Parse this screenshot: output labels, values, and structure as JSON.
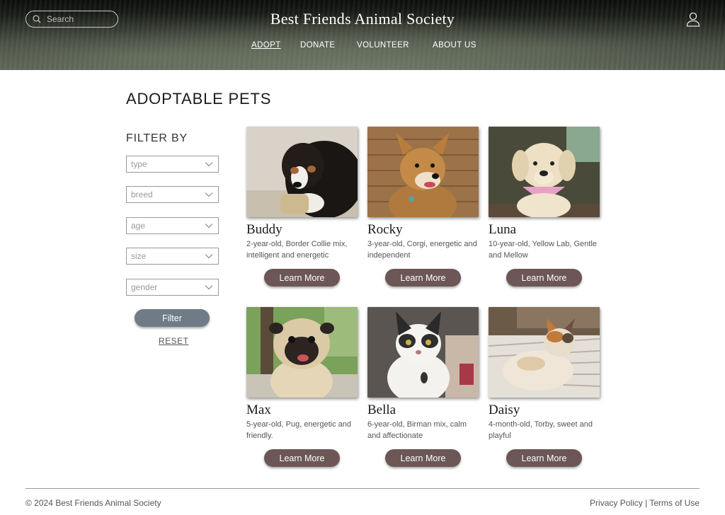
{
  "header": {
    "site_title": "Best Friends Animal Society",
    "search_placeholder": "Search",
    "nav": [
      {
        "label": "ADOPT",
        "active": true
      },
      {
        "label": "DONATE",
        "active": false
      },
      {
        "label": "VOLUNTEER",
        "active": false
      },
      {
        "label": "ABOUT US",
        "active": false
      }
    ],
    "icons": {
      "search": "search-icon",
      "user": "user-icon"
    }
  },
  "main": {
    "page_title": "ADOPTABLE PETS",
    "filter": {
      "heading": "FILTER BY",
      "selects": [
        {
          "placeholder": "type"
        },
        {
          "placeholder": "breed"
        },
        {
          "placeholder": "age"
        },
        {
          "placeholder": "size"
        },
        {
          "placeholder": "gender"
        }
      ],
      "filter_button": "Filter",
      "reset_link": "RESET"
    },
    "pets": [
      {
        "name": "Buddy",
        "description": "2-year-old, Border Collie mix, intelligent and energetic",
        "button": "Learn More"
      },
      {
        "name": "Rocky",
        "description": "3-year-old, Corgi, energetic and independent",
        "button": "Learn More"
      },
      {
        "name": "Luna",
        "description": "10-year-old, Yellow Lab, Gentle and Mellow",
        "button": "Learn More"
      },
      {
        "name": "Max",
        "description": "5-year-old, Pug, energetic and friendly.",
        "button": "Learn More"
      },
      {
        "name": "Bella",
        "description": "6-year-old, Birman mix, calm and affectionate",
        "button": "Learn More"
      },
      {
        "name": "Daisy",
        "description": "4-month-old, Torby, sweet and playful",
        "button": "Learn More"
      }
    ]
  },
  "footer": {
    "copyright": "© 2024 Best Friends Animal Society",
    "privacy": "Privacy Policy",
    "separator": " | ",
    "terms": "Terms of Use"
  },
  "colors": {
    "learn_button": "#6c5656",
    "filter_button": "#6f7b87"
  }
}
